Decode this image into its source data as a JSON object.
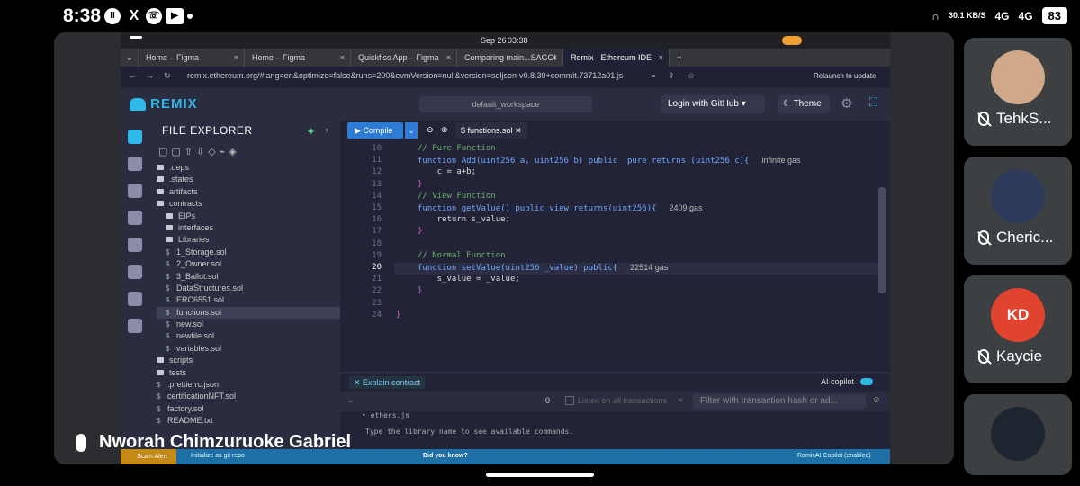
{
  "status_bar": {
    "time": "8:38",
    "net_speed": "30.1 KB/S",
    "signal1": "4G",
    "signal2": "4G",
    "battery": "83"
  },
  "screen_share": {
    "os_bar": {
      "date": "Sep 26",
      "time": "03:38"
    },
    "tabs": [
      {
        "label": "Home – Figma"
      },
      {
        "label": "Home – Figma"
      },
      {
        "label": "Quickfiss App – Figma"
      },
      {
        "label": "Comparing main...SAGGI"
      },
      {
        "label": "Remix - Ethereum IDE"
      }
    ],
    "address": "remix.ethereum.org/#lang=en&optimize=false&runs=200&evmVersion=null&version=soljson-v0.8.30+commit.73712a01.js",
    "relaunch": "Relaunch to update",
    "remix": {
      "logo": "REMIX",
      "workspace": "default_workspace",
      "github_button": "Login with GitHub",
      "theme_button": "Theme",
      "explorer_title": "FILE EXPLORER",
      "tree": [
        {
          "label": ".deps",
          "kind": "folder",
          "indent": 0
        },
        {
          "label": ".states",
          "kind": "folder",
          "indent": 0
        },
        {
          "label": "artifacts",
          "kind": "folder",
          "indent": 0
        },
        {
          "label": "contracts",
          "kind": "folder",
          "indent": 0
        },
        {
          "label": "EIPs",
          "kind": "folder",
          "indent": 1
        },
        {
          "label": "interfaces",
          "kind": "folder",
          "indent": 1
        },
        {
          "label": "Libraries",
          "kind": "folder",
          "indent": 1
        },
        {
          "label": "1_Storage.sol",
          "kind": "file",
          "indent": 1
        },
        {
          "label": "2_Owner.sol",
          "kind": "file",
          "indent": 1
        },
        {
          "label": "3_Ballot.sol",
          "kind": "file",
          "indent": 1
        },
        {
          "label": "DataStructures.sol",
          "kind": "file",
          "indent": 1
        },
        {
          "label": "ERC6551.sol",
          "kind": "file",
          "indent": 1
        },
        {
          "label": "functions.sol",
          "kind": "file",
          "indent": 1,
          "selected": true
        },
        {
          "label": "new.sol",
          "kind": "file",
          "indent": 1
        },
        {
          "label": "newfile.sol",
          "kind": "file",
          "indent": 1
        },
        {
          "label": "variables.sol",
          "kind": "file",
          "indent": 1
        },
        {
          "label": "scripts",
          "kind": "folder",
          "indent": 0
        },
        {
          "label": "tests",
          "kind": "folder",
          "indent": 0
        },
        {
          "label": ".prettierrc.json",
          "kind": "file",
          "indent": 0
        },
        {
          "label": "certificationNFT.sol",
          "kind": "file",
          "indent": 0
        },
        {
          "label": "factory.sol",
          "kind": "file",
          "indent": 0
        },
        {
          "label": "README.txt",
          "kind": "file",
          "indent": 0
        }
      ],
      "compile_button": "Compile",
      "file_tab": "functions.sol",
      "code_lines": [
        {
          "n": "10",
          "text": "// Pure Function",
          "cls": "cm"
        },
        {
          "n": "11",
          "text": "function Add(uint256 a, uint256 b) public  pure returns (uint256 c){",
          "cls": "kw",
          "gas": "infinite gas"
        },
        {
          "n": "12",
          "text": "    c = a+b;",
          "cls": ""
        },
        {
          "n": "13",
          "text": "}",
          "cls": "br"
        },
        {
          "n": "14",
          "text": "// View Function",
          "cls": "cm"
        },
        {
          "n": "15",
          "text": "function getValue() public view returns(uint256){",
          "cls": "kw",
          "gas": "2409 gas"
        },
        {
          "n": "16",
          "text": "    return s_value;",
          "cls": ""
        },
        {
          "n": "17",
          "text": "}",
          "cls": "br"
        },
        {
          "n": "18",
          "text": "",
          "cls": ""
        },
        {
          "n": "19",
          "text": "// Normal Function",
          "cls": "cm"
        },
        {
          "n": "20",
          "text": "function setValue(uint256 _value) public{",
          "cls": "kw",
          "gas": "22514 gas",
          "current": true
        },
        {
          "n": "21",
          "text": "    s_value = _value;",
          "cls": ""
        },
        {
          "n": "22",
          "text": "}",
          "cls": "br"
        },
        {
          "n": "23",
          "text": "",
          "cls": ""
        },
        {
          "n": "24",
          "text": "}",
          "cls": "br",
          "outer": true
        }
      ],
      "explain_button": "Explain contract",
      "ai_copilot": "AI copilot",
      "tx_count": "0",
      "listen_label": "Listen on all transactions",
      "filter_placeholder": "Filter with transaction hash or ad...",
      "terminal_lines": [
        "• ethers.js",
        "Type the library name to see available commands.",
        ">"
      ],
      "status_scam": "Scam Alert",
      "status_git": "Initialize as git repo",
      "status_tip": "Did you know?",
      "status_right": "RemixAI Copilot (enabled)"
    }
  },
  "meet": {
    "speaker_name": "Nworah Chimzuruoke Gabriel",
    "participants": [
      {
        "name": "TehkS...",
        "avatar": "avatar-illustration"
      },
      {
        "name": "Cheric...",
        "avatar": "avatar-photo"
      },
      {
        "name": "Kaycie",
        "initials": "KD",
        "avatar_color": "#e0442f"
      },
      {
        "name": "",
        "avatar": "avatar-photo-dark"
      }
    ]
  }
}
